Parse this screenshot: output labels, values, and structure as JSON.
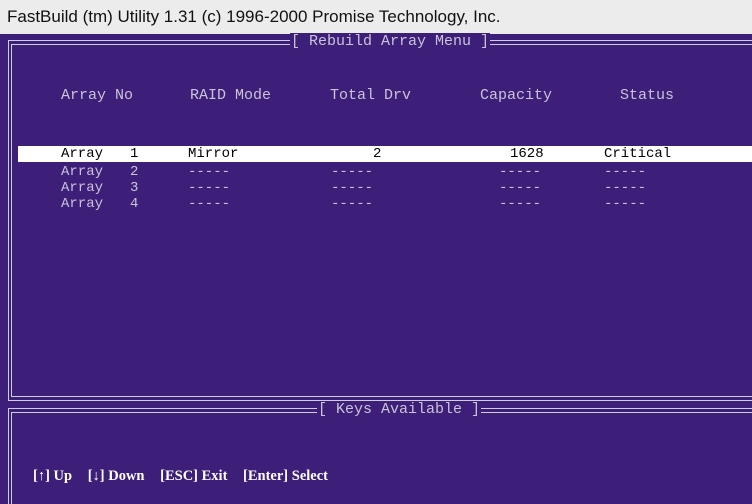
{
  "window": {
    "title": "FastBuild (tm) Utility 1.31 (c) 1996-2000 Promise Technology, Inc."
  },
  "main_panel": {
    "title": "[ Rebuild Array Menu ]",
    "headers": [
      "Array No",
      "RAID Mode",
      "Total Drv",
      "Capacity",
      "Status"
    ],
    "rows": [
      {
        "array": "Array",
        "no": "1",
        "raid_mode": "Mirror",
        "total_drv": "2",
        "capacity": "1628",
        "status": "Critical",
        "selected": true
      },
      {
        "array": "Array",
        "no": "2",
        "raid_mode": "-----",
        "total_drv": "-----",
        "capacity": "-----",
        "status": "-----",
        "selected": false
      },
      {
        "array": "Array",
        "no": "3",
        "raid_mode": "-----",
        "total_drv": "-----",
        "capacity": "-----",
        "status": "-----",
        "selected": false
      },
      {
        "array": "Array",
        "no": "4",
        "raid_mode": "-----",
        "total_drv": "-----",
        "capacity": "-----",
        "status": "-----",
        "selected": false
      }
    ]
  },
  "keys_panel": {
    "title": "[ Keys Available ]",
    "keys": [
      "[↑] Up",
      "[↓] Down",
      "[ESC] Exit",
      "[Enter] Select"
    ]
  },
  "colors": {
    "background": "#3d1e78",
    "title_bar": "#ececec",
    "selected_row": "#ffffff",
    "text": "#c9c4d6"
  }
}
